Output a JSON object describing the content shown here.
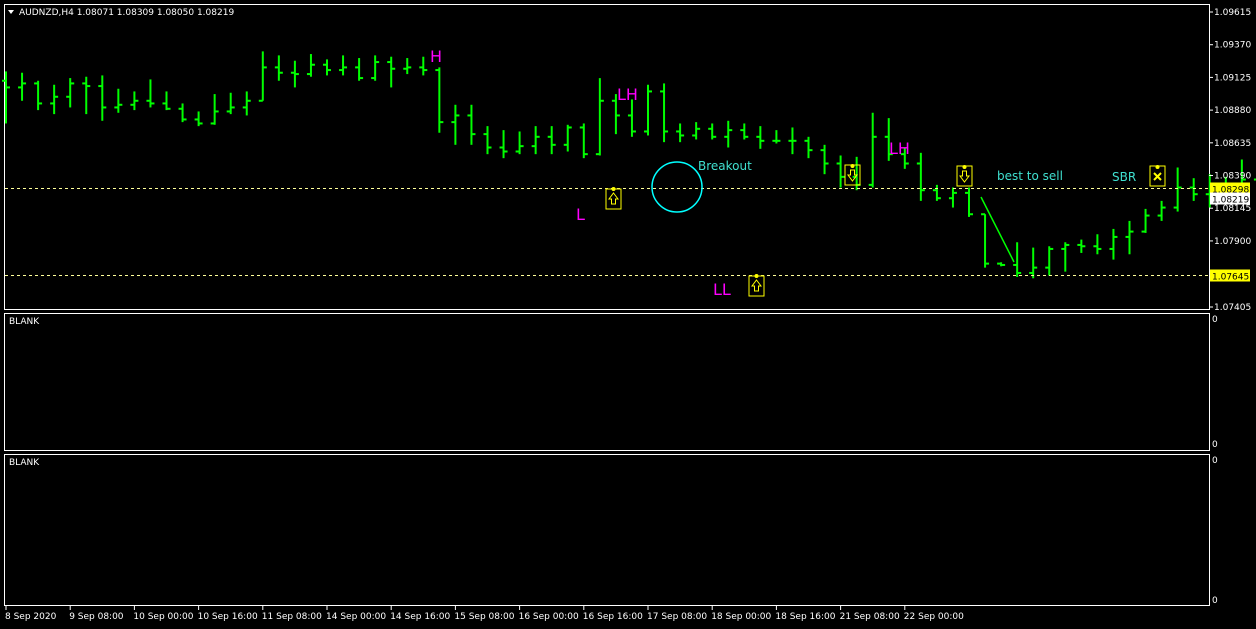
{
  "window": {
    "symbol_title": "AUDNZD,H4  1.08071 1.08309 1.08050 1.08219"
  },
  "colors": {
    "background": "#000000",
    "border": "#ffffff",
    "bar": "#00ff00",
    "grid_level": "#ffff99",
    "price_tag_bg": "#ffff00",
    "current_tag_bg": "#ffffff",
    "swing_label": "#ff00ff",
    "cyan_text": "#40e0d0",
    "circle": "#00ffff",
    "marker": "#ffff00"
  },
  "panels": {
    "blank1_label": "BLANK",
    "blank1_scale_top": "0",
    "blank1_scale_bottom": "0",
    "blank2_label": "BLANK",
    "blank2_scale_top": "0",
    "blank2_scale_bottom": "0"
  },
  "chart_data": {
    "type": "ohlc",
    "symbol": "AUDNZD",
    "timeframe": "H4",
    "current": {
      "open": 1.08071,
      "high": 1.08309,
      "low": 1.0805,
      "close": 1.08219
    },
    "y_ticks": [
      "1.09615",
      "1.09370",
      "1.09125",
      "1.08880",
      "1.08635",
      "1.08390",
      "1.08145",
      "1.07900",
      "1.07645",
      "1.07405"
    ],
    "y_tick_values": [
      1.09615,
      1.0937,
      1.09125,
      1.0888,
      1.08635,
      1.0839,
      1.08145,
      1.079,
      1.07645,
      1.07405
    ],
    "ylim": [
      1.07405,
      1.09615
    ],
    "x_labels": [
      "8 Sep 2020",
      "9 Sep 08:00",
      "10 Sep 00:00",
      "10 Sep 16:00",
      "11 Sep 08:00",
      "14 Sep 00:00",
      "14 Sep 16:00",
      "15 Sep 08:00",
      "16 Sep 00:00",
      "16 Sep 16:00",
      "17 Sep 08:00",
      "18 Sep 00:00",
      "18 Sep 16:00",
      "21 Sep 08:00",
      "22 Sep 00:00"
    ],
    "x_label_bar_index": [
      0,
      4,
      8,
      12,
      16,
      20,
      24,
      28,
      32,
      36,
      40,
      44,
      48,
      52,
      56
    ],
    "price_levels": [
      {
        "value": 1.08298,
        "label": "1.08298",
        "style": "dashed"
      },
      {
        "value": 1.07645,
        "label": "1.07645",
        "style": "dashed"
      }
    ],
    "current_price_label": "1.08219",
    "bars": [
      {
        "o": 1.091,
        "h": 1.0917,
        "l": 1.0878,
        "c": 1.0905
      },
      {
        "o": 1.0905,
        "h": 1.0916,
        "l": 1.0895,
        "c": 1.0908
      },
      {
        "o": 1.0908,
        "h": 1.091,
        "l": 1.0888,
        "c": 1.0893
      },
      {
        "o": 1.0893,
        "h": 1.0907,
        "l": 1.0885,
        "c": 1.0898
      },
      {
        "o": 1.0898,
        "h": 1.0912,
        "l": 1.089,
        "c": 1.0908
      },
      {
        "o": 1.0908,
        "h": 1.0913,
        "l": 1.0885,
        "c": 1.0906
      },
      {
        "o": 1.0906,
        "h": 1.0914,
        "l": 1.088,
        "c": 1.089
      },
      {
        "o": 1.089,
        "h": 1.0904,
        "l": 1.0886,
        "c": 1.0892
      },
      {
        "o": 1.0892,
        "h": 1.0902,
        "l": 1.0888,
        "c": 1.0895
      },
      {
        "o": 1.0895,
        "h": 1.0911,
        "l": 1.089,
        "c": 1.0893
      },
      {
        "o": 1.0893,
        "h": 1.0902,
        "l": 1.0888,
        "c": 1.0889
      },
      {
        "o": 1.0889,
        "h": 1.0893,
        "l": 1.0879,
        "c": 1.0881
      },
      {
        "o": 1.0881,
        "h": 1.0887,
        "l": 1.0876,
        "c": 1.0878
      },
      {
        "o": 1.0878,
        "h": 1.09,
        "l": 1.0877,
        "c": 1.0887
      },
      {
        "o": 1.0887,
        "h": 1.0901,
        "l": 1.0885,
        "c": 1.089
      },
      {
        "o": 1.089,
        "h": 1.0902,
        "l": 1.0884,
        "c": 1.0895
      },
      {
        "o": 1.0895,
        "h": 1.0932,
        "l": 1.0895,
        "c": 1.092
      },
      {
        "o": 1.092,
        "h": 1.0929,
        "l": 1.091,
        "c": 1.0916
      },
      {
        "o": 1.0916,
        "h": 1.0925,
        "l": 1.0905,
        "c": 1.0915
      },
      {
        "o": 1.0915,
        "h": 1.093,
        "l": 1.0913,
        "c": 1.0922
      },
      {
        "o": 1.0922,
        "h": 1.0926,
        "l": 1.0914,
        "c": 1.0918
      },
      {
        "o": 1.0918,
        "h": 1.0929,
        "l": 1.0914,
        "c": 1.092
      },
      {
        "o": 1.092,
        "h": 1.0927,
        "l": 1.091,
        "c": 1.0912
      },
      {
        "o": 1.0912,
        "h": 1.0929,
        "l": 1.091,
        "c": 1.0924
      },
      {
        "o": 1.0924,
        "h": 1.0928,
        "l": 1.0905,
        "c": 1.0919
      },
      {
        "o": 1.0919,
        "h": 1.0927,
        "l": 1.0915,
        "c": 1.092
      },
      {
        "o": 1.092,
        "h": 1.0928,
        "l": 1.0914,
        "c": 1.0918
      },
      {
        "o": 1.0918,
        "h": 1.092,
        "l": 1.0871,
        "c": 1.0879
      },
      {
        "o": 1.0879,
        "h": 1.0892,
        "l": 1.0862,
        "c": 1.0884
      },
      {
        "o": 1.0884,
        "h": 1.0892,
        "l": 1.0862,
        "c": 1.087
      },
      {
        "o": 1.087,
        "h": 1.0876,
        "l": 1.0855,
        "c": 1.086
      },
      {
        "o": 1.086,
        "h": 1.0873,
        "l": 1.0852,
        "c": 1.0857
      },
      {
        "o": 1.0857,
        "h": 1.0872,
        "l": 1.0855,
        "c": 1.0861
      },
      {
        "o": 1.0861,
        "h": 1.0876,
        "l": 1.0855,
        "c": 1.0868
      },
      {
        "o": 1.0868,
        "h": 1.0876,
        "l": 1.0855,
        "c": 1.0862
      },
      {
        "o": 1.0862,
        "h": 1.0877,
        "l": 1.0857,
        "c": 1.0875
      },
      {
        "o": 1.0875,
        "h": 1.0878,
        "l": 1.0852,
        "c": 1.0855
      },
      {
        "o": 1.0855,
        "h": 1.0912,
        "l": 1.0854,
        "c": 1.0895
      },
      {
        "o": 1.0895,
        "h": 1.09,
        "l": 1.087,
        "c": 1.0884
      },
      {
        "o": 1.0884,
        "h": 1.0896,
        "l": 1.0868,
        "c": 1.0872
      },
      {
        "o": 1.0872,
        "h": 1.0907,
        "l": 1.0869,
        "c": 1.0902
      },
      {
        "o": 1.0902,
        "h": 1.0908,
        "l": 1.0864,
        "c": 1.0872
      },
      {
        "o": 1.0872,
        "h": 1.0878,
        "l": 1.0864,
        "c": 1.0869
      },
      {
        "o": 1.0869,
        "h": 1.0879,
        "l": 1.0866,
        "c": 1.0874
      },
      {
        "o": 1.0874,
        "h": 1.0878,
        "l": 1.0866,
        "c": 1.0868
      },
      {
        "o": 1.0868,
        "h": 1.088,
        "l": 1.086,
        "c": 1.0873
      },
      {
        "o": 1.0873,
        "h": 1.0878,
        "l": 1.0866,
        "c": 1.0868
      },
      {
        "o": 1.0868,
        "h": 1.0876,
        "l": 1.0859,
        "c": 1.0865
      },
      {
        "o": 1.0865,
        "h": 1.0873,
        "l": 1.0863,
        "c": 1.0865
      },
      {
        "o": 1.0865,
        "h": 1.0875,
        "l": 1.0855,
        "c": 1.0865
      },
      {
        "o": 1.0865,
        "h": 1.0868,
        "l": 1.0852,
        "c": 1.0858
      }
    ],
    "bars_note_indexes_start": 0,
    "bars_tail": [
      {
        "o": 1.0858,
        "h": 1.0862,
        "l": 1.084,
        "c": 1.0848
      },
      {
        "o": 1.0848,
        "h": 1.0854,
        "l": 1.083,
        "c": 1.0838
      },
      {
        "o": 1.0838,
        "h": 1.0853,
        "l": 1.0828,
        "c": 1.0832
      },
      {
        "o": 1.0832,
        "h": 1.0886,
        "l": 1.083,
        "c": 1.0868
      },
      {
        "o": 1.0868,
        "h": 1.0882,
        "l": 1.085,
        "c": 1.0855
      },
      {
        "o": 1.0855,
        "h": 1.086,
        "l": 1.0844,
        "c": 1.0848
      },
      {
        "o": 1.0848,
        "h": 1.0856,
        "l": 1.082,
        "c": 1.0828
      },
      {
        "o": 1.0828,
        "h": 1.0832,
        "l": 1.082,
        "c": 1.0822
      },
      {
        "o": 1.0822,
        "h": 1.083,
        "l": 1.0815,
        "c": 1.0826
      },
      {
        "o": 1.0826,
        "h": 1.083,
        "l": 1.0808,
        "c": 1.081
      },
      {
        "o": 1.081,
        "h": 1.081,
        "l": 1.077,
        "c": 1.0773
      },
      {
        "o": 1.0773,
        "h": 1.0774,
        "l": 1.0771,
        "c": 1.0772
      },
      {
        "o": 1.0772,
        "h": 1.0789,
        "l": 1.0763,
        "c": 1.0766
      },
      {
        "o": 1.0766,
        "h": 1.0785,
        "l": 1.0762,
        "c": 1.077
      },
      {
        "o": 1.077,
        "h": 1.0786,
        "l": 1.0764,
        "c": 1.0784
      },
      {
        "o": 1.0784,
        "h": 1.0789,
        "l": 1.0767,
        "c": 1.0787
      },
      {
        "o": 1.0787,
        "h": 1.0791,
        "l": 1.0781,
        "c": 1.0786
      },
      {
        "o": 1.0786,
        "h": 1.0795,
        "l": 1.078,
        "c": 1.0784
      },
      {
        "o": 1.0784,
        "h": 1.0799,
        "l": 1.0776,
        "c": 1.0793
      },
      {
        "o": 1.0793,
        "h": 1.0805,
        "l": 1.078,
        "c": 1.0797
      },
      {
        "o": 1.0797,
        "h": 1.0814,
        "l": 1.0796,
        "c": 1.0809
      },
      {
        "o": 1.0809,
        "h": 1.082,
        "l": 1.0805,
        "c": 1.0815
      },
      {
        "o": 1.0815,
        "h": 1.0845,
        "l": 1.0812,
        "c": 1.083
      },
      {
        "o": 1.083,
        "h": 1.0837,
        "l": 1.082,
        "c": 1.0825
      },
      {
        "o": 1.0825,
        "h": 1.084,
        "l": 1.0815,
        "c": 1.0826
      },
      {
        "o": 1.0826,
        "h": 1.0838,
        "l": 1.0819,
        "c": 1.0822
      },
      {
        "o": 1.0822,
        "h": 1.0851,
        "l": 1.082,
        "c": 1.0836
      },
      {
        "o": 1.0836,
        "h": 1.0838,
        "l": 1.0818,
        "c": 1.0824
      },
      {
        "o": 1.0824,
        "h": 1.0829,
        "l": 1.0803,
        "c": 1.0818
      },
      {
        "o": 1.0818,
        "h": 1.0822,
        "l": 1.08,
        "c": 1.0816
      },
      {
        "o": 1.0816,
        "h": 1.0825,
        "l": 1.0805,
        "c": 1.081
      },
      {
        "o": 1.0807,
        "h": 1.0831,
        "l": 1.0805,
        "c": 1.0822
      }
    ],
    "annotations": [
      {
        "text": "H",
        "color": "#ff00ff"
      },
      {
        "text": "LH",
        "color": "#ff00ff"
      },
      {
        "text": "L",
        "color": "#ff00ff"
      },
      {
        "text": "LL",
        "color": "#ff00ff"
      },
      {
        "text": "LH",
        "color": "#ff00ff"
      },
      {
        "text": "Breakout",
        "color": "#40e0d0"
      },
      {
        "text": "best to sell",
        "color": "#40e0d0"
      },
      {
        "text": "SBR",
        "color": "#40e0d0"
      }
    ],
    "arrow_markers": [
      {
        "direction": "up"
      },
      {
        "direction": "up"
      },
      {
        "direction": "down"
      },
      {
        "direction": "down"
      },
      {
        "direction": "stop"
      }
    ]
  }
}
